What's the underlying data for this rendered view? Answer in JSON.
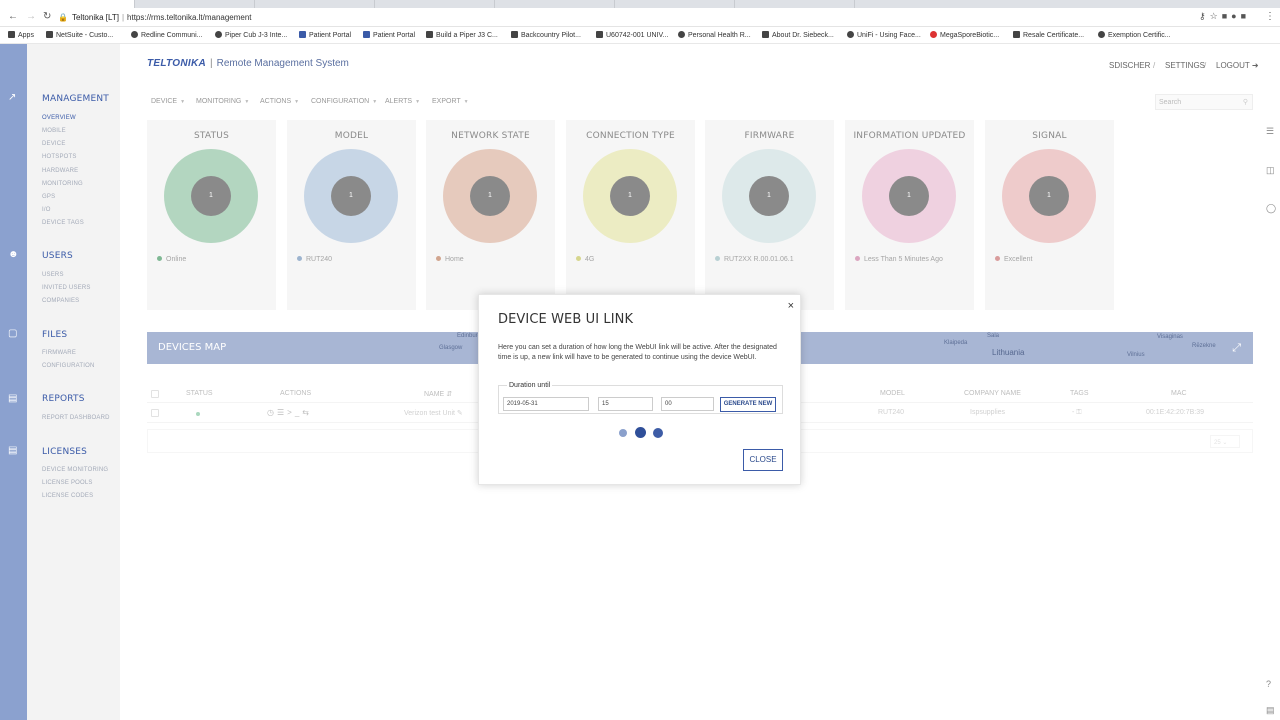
{
  "browser": {
    "tab_title": "Teltonika [LT]",
    "url_site": "Teltonika [LT]",
    "url": "https://rms.teltonika.lt/management",
    "bookmarks": [
      {
        "label": "Apps"
      },
      {
        "label": "NetSuite - Custo..."
      },
      {
        "label": "Redline Communi..."
      },
      {
        "label": "Piper Cub J-3 Inte..."
      },
      {
        "label": "Patient Portal"
      },
      {
        "label": "Patient Portal"
      },
      {
        "label": "Build a Piper J3 C..."
      },
      {
        "label": "Backcountry Pilot..."
      },
      {
        "label": "U60742-001 UNIV..."
      },
      {
        "label": "Personal Health R..."
      },
      {
        "label": "About Dr. Siebeck..."
      },
      {
        "label": "UniFi - Using Face..."
      },
      {
        "label": "MegaSporeBiotic..."
      },
      {
        "label": "Resale Certificate..."
      },
      {
        "label": "Exemption Certific..."
      }
    ]
  },
  "header": {
    "brand": "TELTONIKA",
    "divider": "|",
    "product": "Remote Management System",
    "user": "SDISCHER",
    "settings": "SETTINGS",
    "logout": "LOGOUT",
    "sep": "/"
  },
  "sidebar": {
    "sections": [
      {
        "title": "MANAGEMENT",
        "items": [
          "OVERVIEW",
          "MOBILE",
          "DEVICE",
          "HOTSPOTS",
          "HARDWARE",
          "MONITORING",
          "GPS",
          "I/O",
          "DEVICE TAGS"
        ]
      },
      {
        "title": "USERS",
        "items": [
          "USERS",
          "INVITED USERS",
          "COMPANIES"
        ]
      },
      {
        "title": "FILES",
        "items": [
          "FIRMWARE",
          "CONFIGURATION"
        ]
      },
      {
        "title": "REPORTS",
        "items": [
          "REPORT DASHBOARD"
        ]
      },
      {
        "title": "LICENSES",
        "items": [
          "DEVICE MONITORING",
          "LICENSE POOLS",
          "LICENSE CODES"
        ]
      }
    ]
  },
  "menu": {
    "items": [
      "DEVICE",
      "MONITORING",
      "ACTIONS",
      "CONFIGURATION",
      "ALERTS",
      "EXPORT"
    ],
    "search_placeholder": "Search"
  },
  "cards": [
    {
      "title": "STATUS",
      "count": "1",
      "legend": "Online",
      "ring_color": "#b3d6c0",
      "dot_color": "#7fb894"
    },
    {
      "title": "MODEL",
      "count": "1",
      "legend": "RUT240",
      "ring_color": "#c7d6e6",
      "dot_color": "#9db4cf"
    },
    {
      "title": "NETWORK STATE",
      "count": "1",
      "legend": "Home",
      "ring_color": "#e6cabd",
      "dot_color": "#d1a58f"
    },
    {
      "title": "CONNECTION TYPE",
      "count": "1",
      "legend": "4G",
      "ring_color": "#ececc3",
      "dot_color": "#d6d68e"
    },
    {
      "title": "FIRMWARE",
      "count": "1",
      "legend": "RUT2XX R.00.01.06.1",
      "ring_color": "#dde9ea",
      "dot_color": "#b8d0d3"
    },
    {
      "title": "INFORMATION UPDATED",
      "count": "1",
      "legend": "Less Than 5 Minutes Ago",
      "ring_color": "#efd1e0",
      "dot_color": "#dba6c0"
    },
    {
      "title": "SIGNAL",
      "count": "1",
      "legend": "Excellent",
      "ring_color": "#eecbcb",
      "dot_color": "#d99c9c"
    }
  ],
  "devices_map": {
    "title": "DEVICES MAP",
    "labels": [
      "Edinburgh",
      "Glasgow",
      "Klaipeda",
      "Lithuania",
      "Vilnius",
      "Sala",
      "Visaginas",
      "Rēzekne"
    ]
  },
  "table": {
    "headers": {
      "status": "STATUS",
      "actions": "ACTIONS",
      "name": "NAME",
      "model": "MODEL",
      "company": "COMPANY NAME",
      "tags": "TAGS",
      "mac": "MAC"
    },
    "rows": [
      {
        "name": "Verizon test Unit",
        "model": "RUT240",
        "company": "Ispsupplies",
        "tags": "- ⚿",
        "mac": "00:1E:42:20:7B:39"
      }
    ],
    "page_size": "25"
  },
  "modal": {
    "title": "DEVICE WEB UI LINK",
    "close_x": "×",
    "description": "Here you can set a duration of how long the WebUI link will be active. After the designated time is up, a new link will have to be generated to continue using the device WebUI.",
    "duration_legend": "Duration until",
    "date": "2019-05-31",
    "hour": "15",
    "minute": "00",
    "colon": ":",
    "generate_label": "GENERATE NEW",
    "close_label": "CLOSE"
  }
}
